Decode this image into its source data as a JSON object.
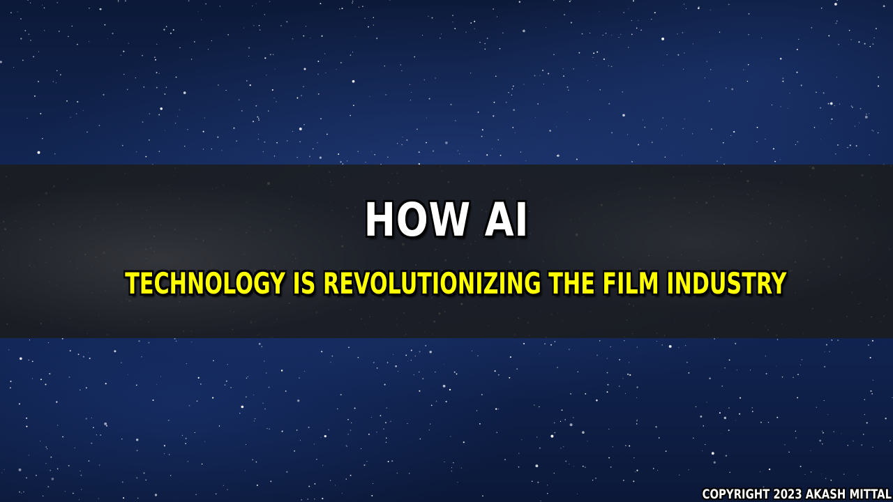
{
  "banner": {
    "title": "HOW AI",
    "subtitle": "TECHNOLOGY IS REVOLUTIONIZING THE FILM INDUSTRY",
    "title_color": "#ffffff",
    "subtitle_color": "#ffff00",
    "band_color": "#1c1c1c"
  },
  "background": {
    "description_icon": "starfield-background",
    "sky_color": "#142a5c"
  },
  "footer": {
    "copyright": "COPYRIGHT 2023 AKASH MITTAL"
  }
}
